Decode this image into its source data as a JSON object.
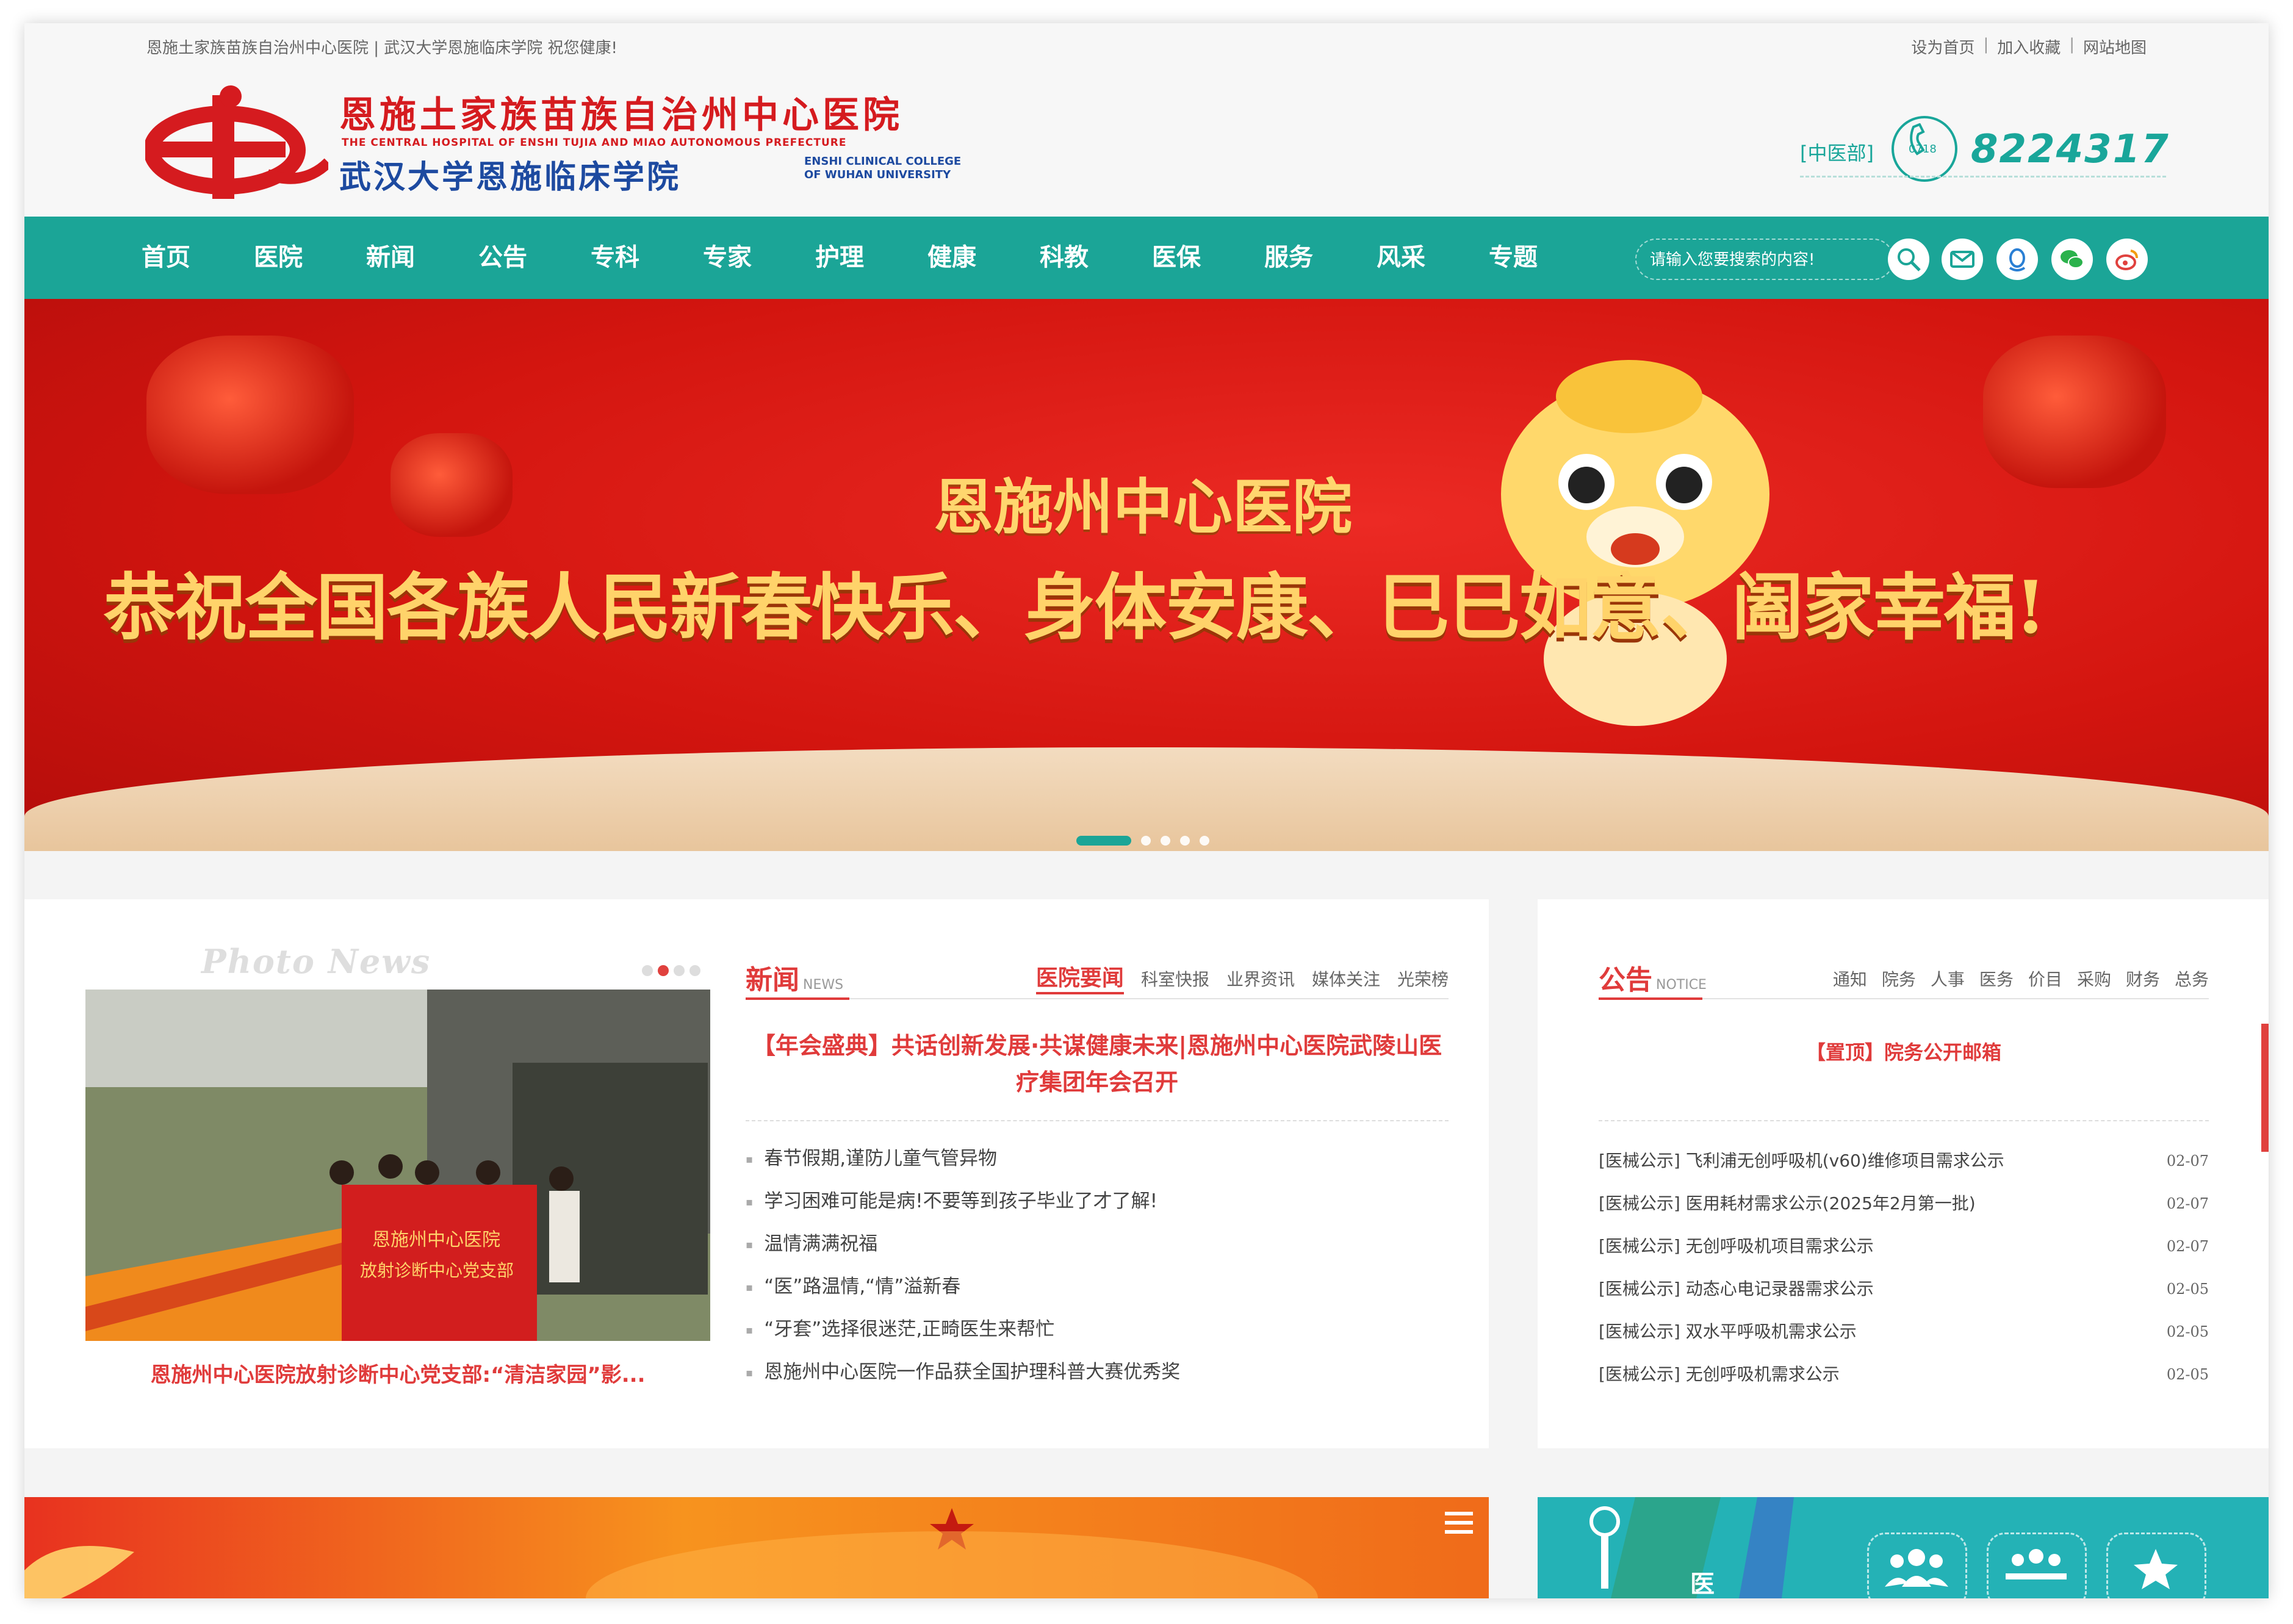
{
  "topbar": {
    "intro": "恩施土家族苗族自治州中心医院 | 武汉大学恩施临床学院 祝您健康!",
    "links": [
      "设为首页",
      "加入收藏",
      "网站地图"
    ]
  },
  "logo": {
    "cn_name": "恩施土家族苗族自治州中心医院",
    "en_name": "THE CENTRAL HOSPITAL OF ENSHI TUJIA AND MIAO AUTONOMOUS PREFECTURE",
    "cn_college": "武汉大学恩施临床学院",
    "en_college_1": "ENSHI CLINICAL COLLEGE",
    "en_college_2": "OF WUHAN UNIVERSITY"
  },
  "hotline": {
    "tag": "[中医部]",
    "area": "0718",
    "number": "8224317"
  },
  "nav": {
    "items": [
      "首页",
      "医院",
      "新闻",
      "公告",
      "专科",
      "专家",
      "护理",
      "健康",
      "科教",
      "医保",
      "服务",
      "风采",
      "专题"
    ],
    "search_placeholder": "请输入您要搜索的内容!"
  },
  "banner": {
    "subtitle": "恩施州中心医院",
    "title": "恭祝全国各族人民新春快乐、身体安康、巳巳如意、阖家幸福!",
    "slide_count": 5,
    "active_slide": 1
  },
  "photo_news": {
    "heading": "Photo News",
    "caption": "恩施州中心医院放射诊断中心党支部:“清洁家园”影...",
    "banner_text_1": "恩施州中心医院",
    "banner_text_2": "放射诊断中心党支部",
    "dot_count": 4,
    "active_dot": 2
  },
  "news": {
    "title": "新闻",
    "title_en": "NEWS",
    "tabs": [
      "医院要闻",
      "科室快报",
      "业界资讯",
      "媒体关注",
      "光荣榜"
    ],
    "headline": "【年会盛典】共话创新发展·共谋健康未来|恩施州中心医院武陵山医疗集团年会召开",
    "items": [
      "春节假期,谨防儿童气管异物",
      "学习困难可能是病!不要等到孩子毕业了才了解!",
      "温情满满祝福",
      "“医”路温情,“情”溢新春",
      "“牙套”选择很迷茫,正畸医生来帮忙",
      "恩施州中心医院一作品获全国护理科普大赛优秀奖"
    ]
  },
  "notice": {
    "title": "公告",
    "title_en": "NOTICE",
    "tabs": [
      "通知",
      "院务",
      "人事",
      "医务",
      "价目",
      "采购",
      "财务",
      "总务"
    ],
    "top_item": "【置顶】院务公开邮箱",
    "items": [
      {
        "text": "[医械公示] 飞利浦无创呼吸机(v60)维修项目需求公示",
        "date": "02-07"
      },
      {
        "text": "[医械公示] 医用耗材需求公示(2025年2月第一批)",
        "date": "02-07"
      },
      {
        "text": "[医械公示] 无创呼吸机项目需求公示",
        "date": "02-07"
      },
      {
        "text": "[医械公示] 动态心电记录器需求公示",
        "date": "02-05"
      },
      {
        "text": "[医械公示] 双水平呼吸机需求公示",
        "date": "02-05"
      },
      {
        "text": "[医械公示] 无创呼吸机需求公示",
        "date": "02-05"
      }
    ]
  },
  "bottom_right": {
    "label": "医"
  },
  "colors": {
    "teal": "#1ba597",
    "red": "#e03b3b",
    "banner_red": "#d3150f",
    "gold": "#ffd36a"
  }
}
